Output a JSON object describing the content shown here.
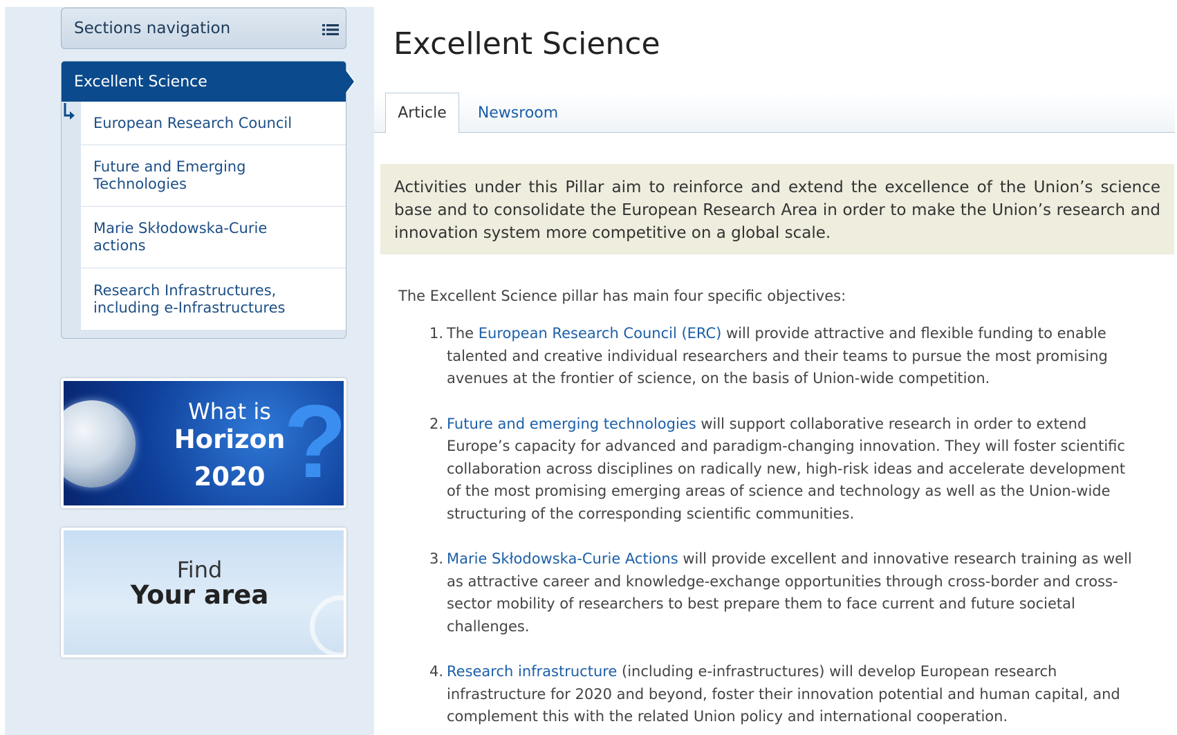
{
  "sidebar": {
    "sections_nav_label": "Sections navigation",
    "active_item": "Excellent Science",
    "sub_items": [
      {
        "label": "European Research Council"
      },
      {
        "label": "Future and Emerging Technologies"
      },
      {
        "label": "Marie Skłodowska-Curie actions"
      },
      {
        "label": "Research Infrastructures, including e-Infrastructures"
      }
    ],
    "banner_h2020": {
      "line1": "What is",
      "line2": "Horizon",
      "line3": "2020",
      "qmark": "?"
    },
    "banner_area": {
      "line1": "Find",
      "line2": "Your area"
    }
  },
  "main": {
    "title": "Excellent Science",
    "tabs": [
      {
        "label": "Article",
        "active": true
      },
      {
        "label": "Newsroom",
        "active": false
      }
    ],
    "intro": "Activities under this Pillar aim to reinforce and extend the excellence of the Union’s science base and to consolidate the European Research Area in order to make the Union’s research and innovation system more competitive on a global scale.",
    "lead": "The Excellent Science pillar has main four specific objectives:",
    "objectives": [
      {
        "num": "1.",
        "pre": "The ",
        "link": "European Research Council (ERC)",
        "rest": " will provide attractive and flexible funding to enable talented and creative individual researchers and their teams to pursue the most promising avenues at the frontier of science, on the basis of Union-wide competition."
      },
      {
        "num": "2.",
        "pre": "",
        "link": "Future and emerging technologies",
        "rest": " will support collaborative research in order to extend Europe’s capacity for advanced and paradigm-changing innovation. They will foster scientific collaboration across disciplines on radically new, high-risk ideas and accelerate development of the most promising emerging areas of science and technology as well as the Union-wide structuring of the corresponding scientific communities."
      },
      {
        "num": "3.",
        "pre": "",
        "link": "Marie Skłodowska-Curie Actions",
        "rest": " will provide excellent and innovative research training as well as attractive career and knowledge-exchange opportunities through cross-border and cross-sector mobility of researchers to best prepare them to face current and future societal challenges."
      },
      {
        "num": "4.",
        "pre": "",
        "link": "Research infrastructure",
        "rest": " (including e-infrastructures) will develop European research infrastructure for 2020 and beyond, foster their innovation potential and human capital, and complement this with the related Union policy and international cooperation."
      }
    ]
  },
  "colors": {
    "nav_active_bg": "#0b4a8c",
    "link": "#1c5fa8",
    "intro_bg": "#efedde",
    "page_bg": "#e3ecf5"
  },
  "icons": {
    "sections_nav": "list-icon",
    "sub_nav_arrow": "corner-arrow-icon",
    "nav_active_pointer": "chevron-right-icon"
  }
}
